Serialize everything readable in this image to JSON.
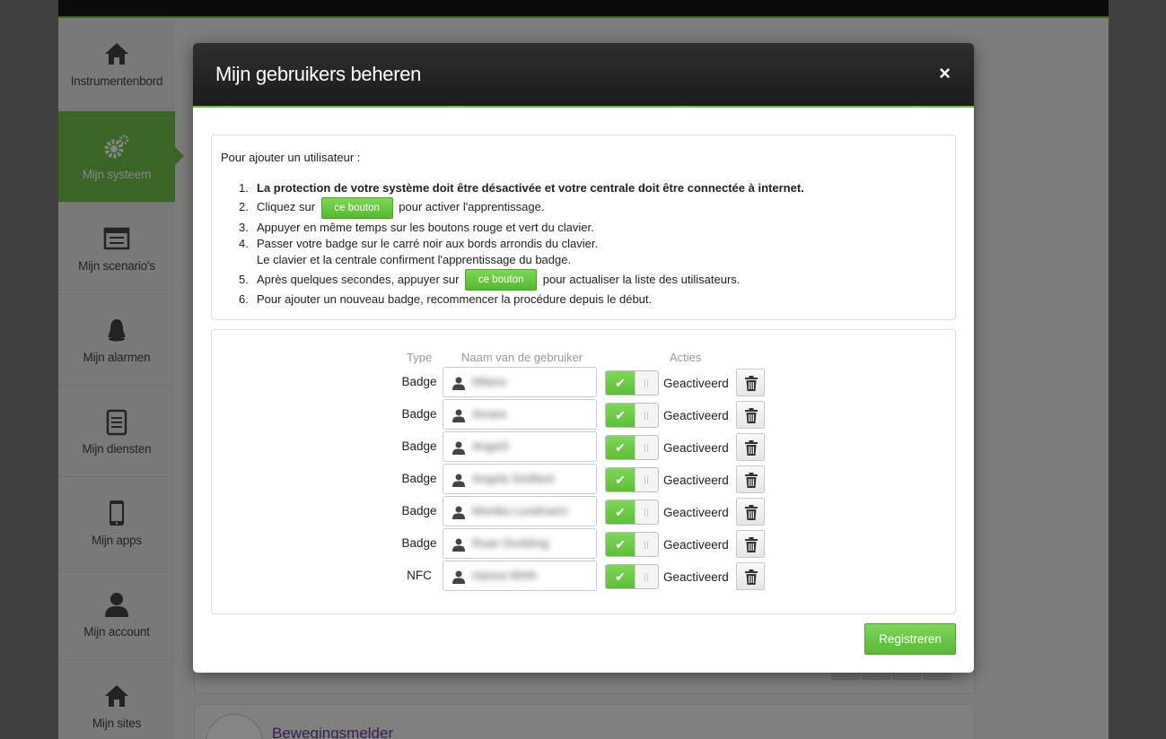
{
  "sidebar": {
    "items": [
      {
        "label": "Instrumentenbord",
        "icon": "home-icon"
      },
      {
        "label": "Mijn systeem",
        "icon": "gears-icon",
        "active": true
      },
      {
        "label": "Mijn scenario's",
        "icon": "scenario-icon"
      },
      {
        "label": "Mijn alarmen",
        "icon": "bell-icon"
      },
      {
        "label": "Mijn diensten",
        "icon": "clipboard-icon"
      },
      {
        "label": "Mijn apps",
        "icon": "phone-icon"
      },
      {
        "label": "Mijn account",
        "icon": "user-icon"
      },
      {
        "label": "Mijn sites",
        "icon": "home-icon"
      }
    ]
  },
  "background": {
    "card_title": "Bewegingsmelder"
  },
  "modal": {
    "title": "Mijn gebruikers beheren",
    "close": "×",
    "instructions": {
      "intro": "Pour ajouter un utilisateur :",
      "steps": [
        {
          "num": "1.",
          "text": "La protection de votre système doit être désactivée et votre centrale doit être connectée à internet."
        },
        {
          "num": "2.",
          "before": "Cliquez sur",
          "button": "ce bouton",
          "after": "pour activer l'apprentissage."
        },
        {
          "num": "3.",
          "text": "Appuyer en même temps sur les boutons rouge et vert du clavier."
        },
        {
          "num": "4.",
          "text": "Passer votre badge sur le carré noir aux bords arrondis du clavier.",
          "text2": "Le clavier et la centrale confirment l'apprentissage du badge."
        },
        {
          "num": "5.",
          "before": "Après quelques secondes, appuyer sur",
          "button": "ce bouton",
          "after": "pour actualiser la liste des utilisateurs."
        },
        {
          "num": "6.",
          "text": "Pour ajouter un nouveau badge, recommencer la procédure depuis le début."
        }
      ]
    },
    "table": {
      "headers": {
        "type": "Type",
        "name": "Naam van de gebruiker",
        "actions": "Acties"
      },
      "rows": [
        {
          "type": "Badge",
          "name": "Milano",
          "status": "Geactiveerd"
        },
        {
          "type": "Badge",
          "name": "Amara",
          "status": "Geactiveerd"
        },
        {
          "type": "Badge",
          "name": "Angel3",
          "status": "Geactiveerd"
        },
        {
          "type": "Badge",
          "name": "Angela Smillard",
          "status": "Geactiveerd"
        },
        {
          "type": "Badge",
          "name": "Monika Lundmann",
          "status": "Geactiveerd"
        },
        {
          "type": "Badge",
          "name": "Ruan Dunkling",
          "status": "Geactiveerd"
        },
        {
          "type": "NFC",
          "name": "Hanna Wirth",
          "status": "Geactiveerd"
        }
      ]
    },
    "register_label": "Registreren"
  }
}
